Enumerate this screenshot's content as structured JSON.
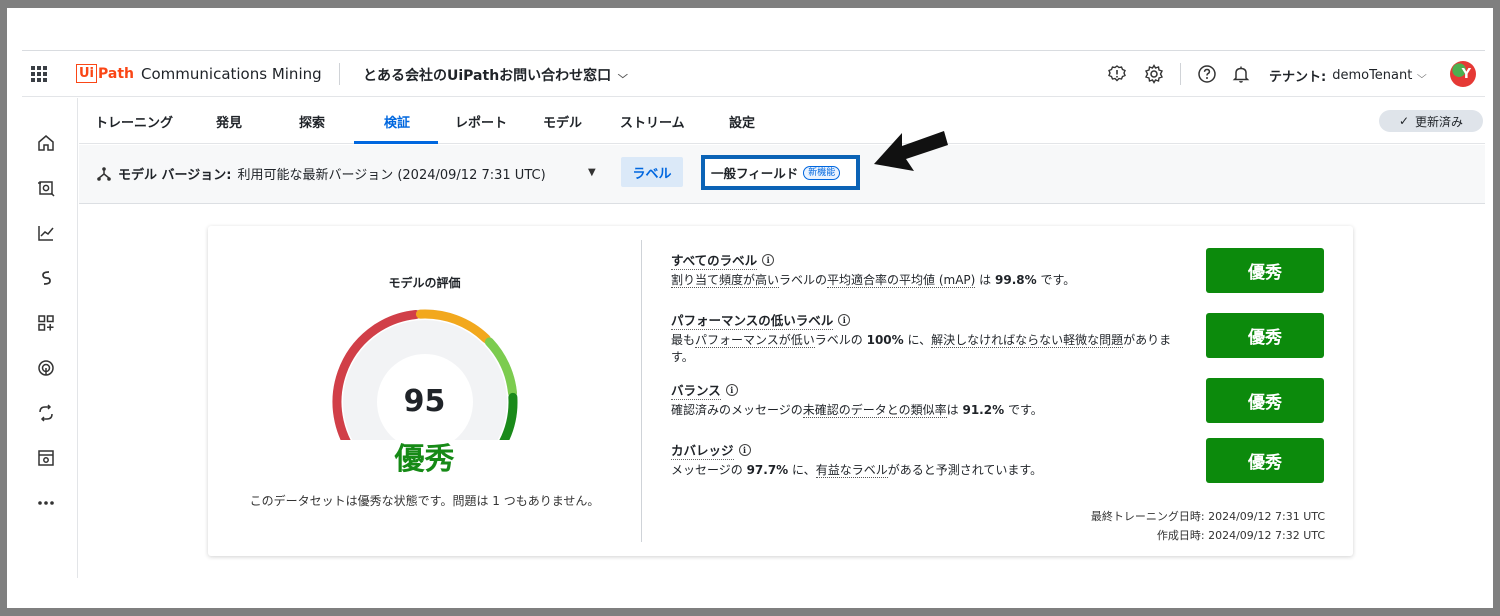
{
  "header": {
    "logo_ui": "Ui",
    "logo_path": "Path",
    "product": "Communications Mining",
    "project": "とある会社のUiPathお問い合わせ窓口",
    "tenant_label": "テナント:",
    "tenant_value": "demoTenant",
    "avatar_initial": "Y",
    "icons": [
      "apps-grid-icon",
      "alert-icon",
      "gear-icon",
      "help-icon",
      "bell-icon"
    ]
  },
  "sidebar": {
    "icons": [
      "home-icon",
      "dataset-icon",
      "chart-icon",
      "streams-icon",
      "apps-add-icon",
      "signal-icon",
      "sync-icon",
      "store-icon",
      "more-icon"
    ]
  },
  "tabs": [
    {
      "label": "トレーニング"
    },
    {
      "label": "発見"
    },
    {
      "label": "探索"
    },
    {
      "label": "検証",
      "active": true
    },
    {
      "label": "レポート"
    },
    {
      "label": "モデル"
    },
    {
      "label": "ストリーム"
    },
    {
      "label": "設定"
    }
  ],
  "status_pill": "更新済み",
  "subbar": {
    "model_version_label": "モデル バージョン:",
    "model_version_value": "利用可能な最新バージョン (2024/09/12 7:31 UTC)",
    "label_button": "ラベル",
    "general_fields_button": "一般フィールド",
    "new_badge": "新機能"
  },
  "evaluation": {
    "title": "モデルの評価",
    "score": "95",
    "grade": "優秀",
    "summary": "このデータセットは優秀な状態です。問題は 1 つもありません。",
    "gauge_fraction": 0.95
  },
  "metrics": [
    {
      "title": "すべてのラベル",
      "desc_pre": "",
      "desc_u1": "割り当て頻度が高い",
      "desc_mid1": "ラベルの",
      "desc_u2": "平均適合率の平均値 (mAP)",
      "desc_mid2": " は ",
      "desc_value": "99.8%",
      "desc_post": " です。",
      "grade": "優秀"
    },
    {
      "title": "パフォーマンスの低いラベル",
      "desc_pre": "最も",
      "desc_u1": "パフォーマンスが低い",
      "desc_mid1": "ラベルの ",
      "desc_value": "100%",
      "desc_mid2": " に、",
      "desc_u2": "解決しなければならない軽微な問題",
      "desc_post": "があります。",
      "grade": "優秀"
    },
    {
      "title": "バランス",
      "desc_pre": "確認済みのメッセージの",
      "desc_u1": "未確認のデータとの類似率",
      "desc_mid1": "は ",
      "desc_value": "91.2%",
      "desc_post": " です。",
      "grade": "優秀"
    },
    {
      "title": "カバレッジ",
      "desc_pre": "メッセージの ",
      "desc_value": "97.7%",
      "desc_mid1": " に、",
      "desc_u1": "有益なラベル",
      "desc_post": "があると予測されています。",
      "grade": "優秀"
    }
  ],
  "meta": {
    "last_trained": "最終トレーニング日時: 2024/09/12 7:31 UTC",
    "created": "作成日時: 2024/09/12 7:32 UTC"
  },
  "colors": {
    "accent": "#0067df",
    "excellent": "#0c8a0c",
    "gauge_red": "#d13f48",
    "gauge_orange": "#f2a81d",
    "gauge_lightgreen": "#7ccc4f",
    "gauge_green": "#1a8a1a"
  }
}
